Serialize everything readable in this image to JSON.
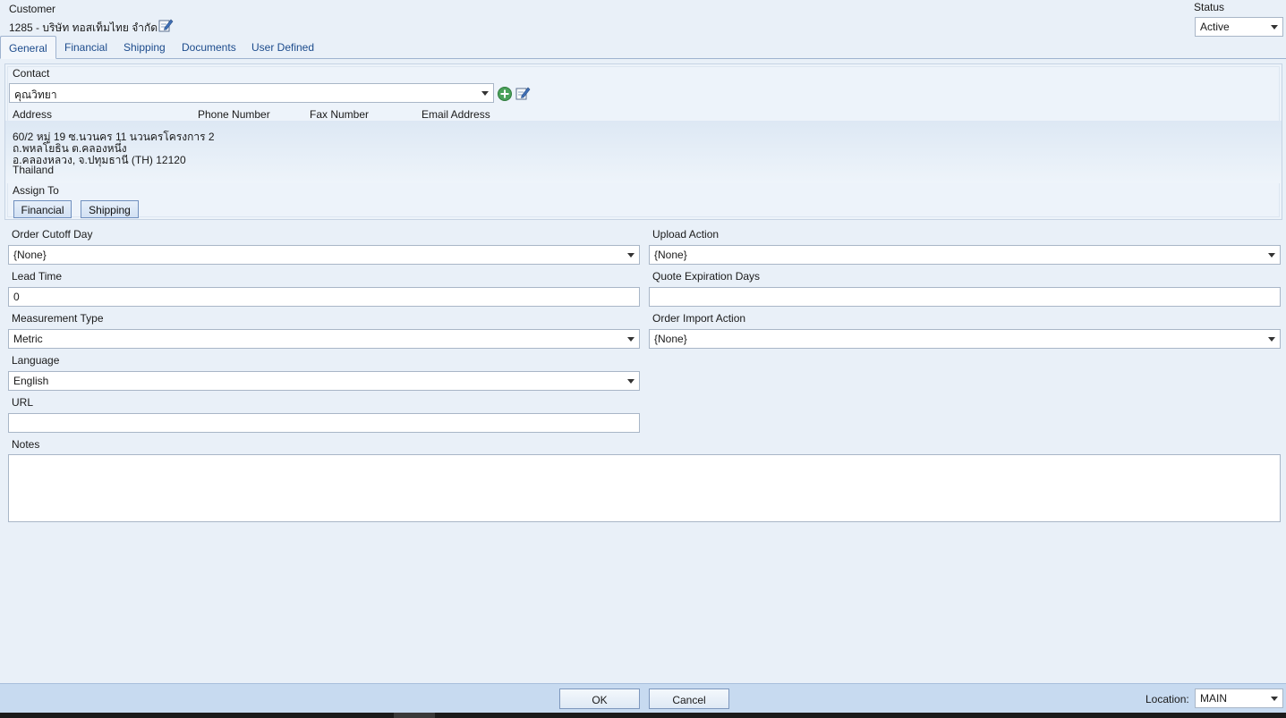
{
  "header": {
    "customer_label": "Customer",
    "customer_name": "1285 - บริษัท ทอสเท็มไทย  จำกัด",
    "status_label": "Status",
    "status_value": "Active"
  },
  "tabs": [
    {
      "label": "General",
      "active": true
    },
    {
      "label": "Financial",
      "active": false
    },
    {
      "label": "Shipping",
      "active": false
    },
    {
      "label": "Documents",
      "active": false
    },
    {
      "label": "User Defined",
      "active": false
    }
  ],
  "contact": {
    "label": "Contact",
    "value": "คุณวิทยา",
    "columns": [
      "Address",
      "Phone Number",
      "Fax Number",
      "Email Address"
    ],
    "address_lines": [
      "60/2 หมู่ 19 ซ.นวนคร 11 นวนครโครงการ 2",
      "ถ.พหลโยธิน ต.คลองหนึ่ง",
      "อ.คลองหลวง, จ.ปทุมธานี (TH)  12120",
      "Thailand"
    ],
    "assign_to_label": "Assign To",
    "assign_buttons": [
      "Financial",
      "Shipping"
    ]
  },
  "fields": {
    "order_cutoff_day": {
      "label": "Order Cutoff Day",
      "value": "{None}"
    },
    "upload_action": {
      "label": "Upload Action",
      "value": "{None}"
    },
    "lead_time": {
      "label": "Lead Time",
      "value": "0"
    },
    "quote_expiration_days": {
      "label": "Quote Expiration Days",
      "value": ""
    },
    "measurement_type": {
      "label": "Measurement Type",
      "value": "Metric"
    },
    "order_import_action": {
      "label": "Order Import Action",
      "value": "{None}"
    },
    "language": {
      "label": "Language",
      "value": "English"
    },
    "url": {
      "label": "URL",
      "value": ""
    },
    "notes": {
      "label": "Notes",
      "value": ""
    }
  },
  "footer": {
    "ok_label": "OK",
    "cancel_label": "Cancel",
    "location_label": "Location:",
    "location_value": "MAIN"
  },
  "colors": {
    "background": "#e9f0f8",
    "tab_text": "#1c4b8c",
    "footer_bg": "#c7daf0",
    "add_icon": "#4aa15a"
  },
  "icons": [
    "edit-icon",
    "add-contact-icon",
    "edit-contact-icon",
    "chevron-down-icon"
  ]
}
